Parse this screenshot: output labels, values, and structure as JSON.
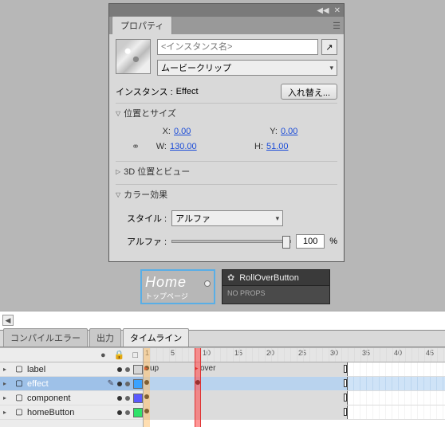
{
  "panel": {
    "tab": "プロパティ",
    "instance_placeholder": "<インスタンス名>",
    "type_label": "ムービークリップ",
    "instance_prefix": "インスタンス :",
    "instance_value": "Effect",
    "swap_btn": "入れ替え...",
    "sections": {
      "pos_size": "位置とサイズ",
      "pos3d": "3D 位置とビュー",
      "color": "カラー効果"
    },
    "coords": {
      "xlabel": "X:",
      "x": "0.00",
      "ylabel": "Y:",
      "y": "0.00",
      "wlabel": "W:",
      "w": "130.00",
      "hlabel": "H:",
      "h": "51.00"
    },
    "style_label": "スタイル :",
    "style_value": "アルファ",
    "alpha_label": "アルファ :",
    "alpha_value": "100",
    "alpha_unit": "%"
  },
  "stage": {
    "home_title": "Home",
    "home_sub": "トップページ",
    "rob_title": "RollOverButton",
    "rob_body": "NO PROPS"
  },
  "lower_tabs": {
    "t1": "コンパイルエラー",
    "t2": "出力",
    "t3": "タイムライン"
  },
  "layers_head": {
    "eye": "●",
    "lock": "•",
    "out": "□",
    "one": "1"
  },
  "layers": [
    {
      "name": "label",
      "color": "#d6d6d6"
    },
    {
      "name": "effect",
      "color": "#3aa2ff",
      "selected": true
    },
    {
      "name": "component",
      "color": "#5a5aff"
    },
    {
      "name": "homeButton",
      "color": "#2ee26a"
    }
  ],
  "ruler": {
    "marks": [
      1,
      5,
      10,
      15,
      20,
      25,
      30,
      35,
      40,
      45
    ]
  },
  "track_labels": {
    "up": "up",
    "over": "over"
  },
  "playhead_frame": 9
}
